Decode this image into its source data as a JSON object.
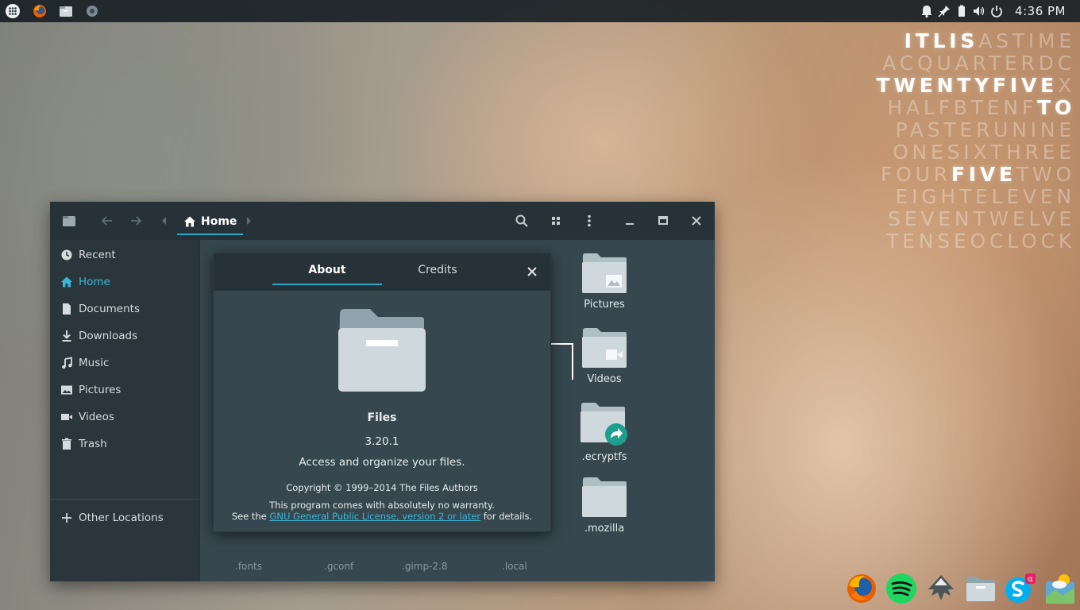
{
  "top_panel": {
    "clock": "4:36 PM",
    "left_icons": [
      "apps-grid-icon",
      "firefox-icon",
      "files-icon",
      "settings-icon"
    ],
    "tray_icons": [
      "notification-bell-icon",
      "pin-icon",
      "battery-icon",
      "volume-icon",
      "power-icon"
    ]
  },
  "word_clock": {
    "lines": [
      {
        "dim_before": "",
        "on": "ITLIS",
        "dim_after": "ASTIME"
      },
      {
        "dim_before": "ACQUARTERDC",
        "on": "",
        "dim_after": ""
      },
      {
        "dim_before": "",
        "on": "TWENTYFIVE",
        "dim_after": "X"
      },
      {
        "dim_before": "HALFBTENF",
        "on": "TO",
        "dim_after": ""
      },
      {
        "dim_before": "PASTERUNINE",
        "on": "",
        "dim_after": ""
      },
      {
        "dim_before": "ONESIXTHREE",
        "on": "",
        "dim_after": ""
      },
      {
        "dim_before": "FOUR",
        "on": "FIVE",
        "dim_after": "TWO"
      },
      {
        "dim_before": "EIGHTELEVEN",
        "on": "",
        "dim_after": ""
      },
      {
        "dim_before": "SEVENTWELVE",
        "on": "",
        "dim_after": ""
      },
      {
        "dim_before": "TENSEOCLOCK",
        "on": "",
        "dim_after": ""
      }
    ]
  },
  "files_window": {
    "breadcrumb": "Home",
    "sidebar": {
      "items": [
        {
          "label": "Recent",
          "icon": "clock-icon",
          "active": false
        },
        {
          "label": "Home",
          "icon": "home-icon",
          "active": true
        },
        {
          "label": "Documents",
          "icon": "document-icon",
          "active": false
        },
        {
          "label": "Downloads",
          "icon": "download-icon",
          "active": false
        },
        {
          "label": "Music",
          "icon": "music-icon",
          "active": false
        },
        {
          "label": "Pictures",
          "icon": "picture-icon",
          "active": false
        },
        {
          "label": "Videos",
          "icon": "video-icon",
          "active": false
        },
        {
          "label": "Trash",
          "icon": "trash-icon",
          "active": false
        }
      ],
      "other_locations": "Other Locations"
    },
    "folders": [
      {
        "label": "Pictures",
        "icon": "picture-folder-icon"
      },
      {
        "label": "Videos",
        "icon": "video-folder-icon"
      },
      {
        "label": ".ecryptfs",
        "icon": "link-folder-icon"
      },
      {
        "label": ".mozilla",
        "icon": "folder-icon"
      }
    ],
    "partial_labels": [
      ".fonts",
      ".gconf",
      ".gimp-2.8",
      ".local"
    ]
  },
  "about_dialog": {
    "tabs": [
      "About",
      "Credits"
    ],
    "app_name": "Files",
    "version": "3.20.1",
    "description": "Access and organize your files.",
    "copyright": "Copyright © 1999–2014 The Files Authors",
    "warranty": "This program comes with absolutely no warranty.",
    "license_prefix": "See the",
    "license_link": "GNU General Public License, version 2 or later",
    "license_suffix": "for details."
  },
  "dock": {
    "icons": [
      "firefox-icon",
      "spotify-icon",
      "inkscape-icon",
      "files-icon",
      "skype-icon",
      "weather-icon"
    ]
  },
  "colors": {
    "accent": "#26a9c7",
    "window_bg": "#37474f",
    "header_bg": "#263238"
  }
}
